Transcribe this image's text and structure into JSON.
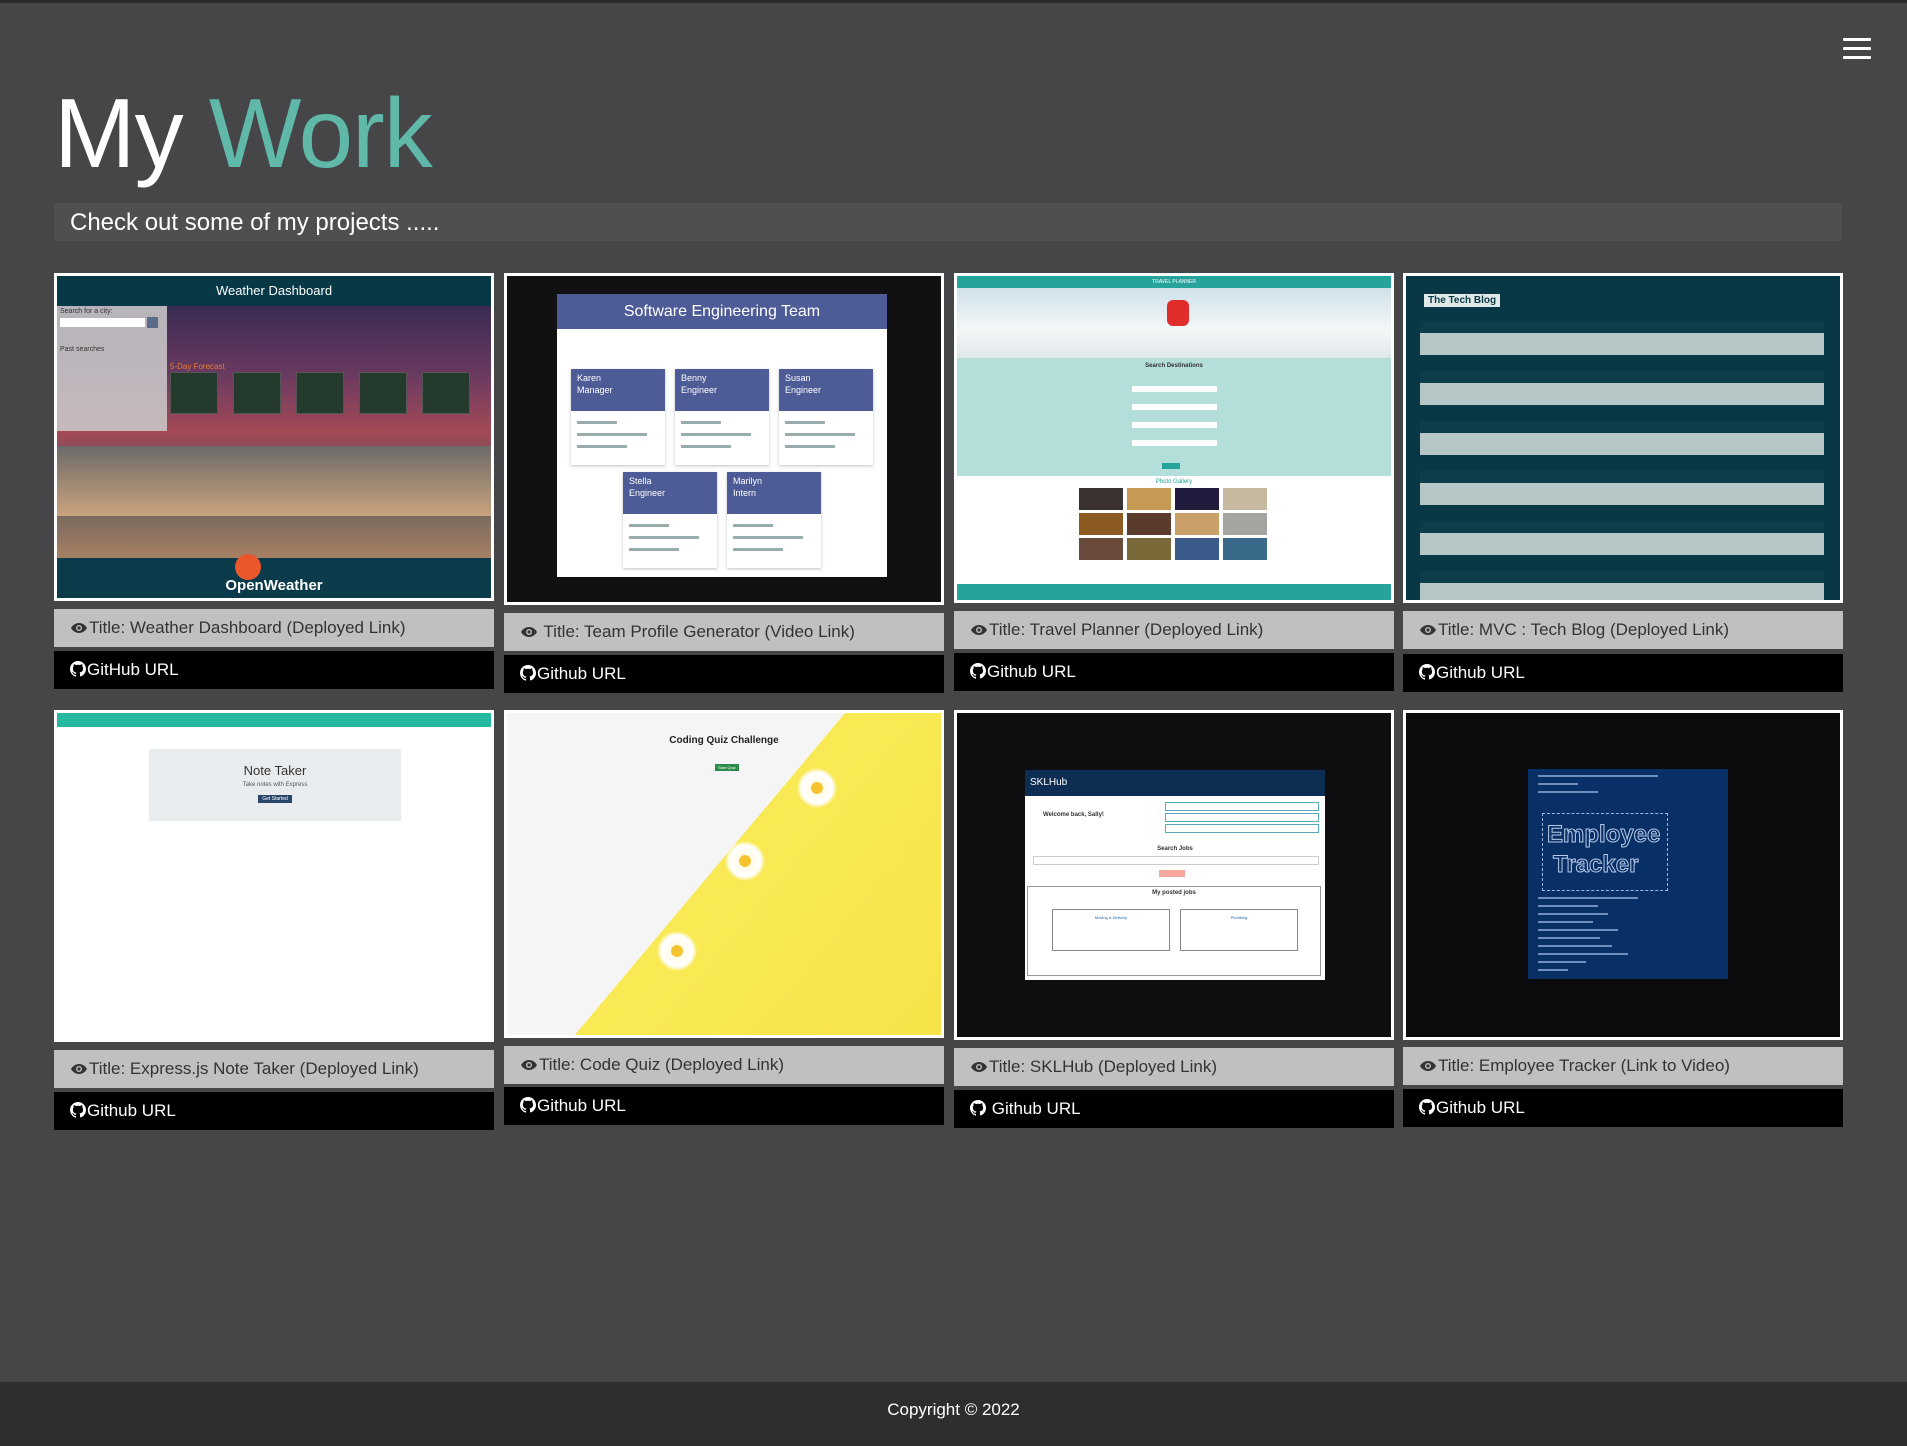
{
  "header": {
    "title_part1": "My",
    "title_part2": "Work",
    "subtitle": "Check out some of my projects ....."
  },
  "colors": {
    "background": "#464648",
    "accent": "#5fb8a8",
    "caption_bg": "#c0c0c0",
    "link_bar_bg": "#000000",
    "footer_bg": "#2e2e30"
  },
  "icons": {
    "menu": "hamburger-menu-icon",
    "caption": "eye-icon",
    "link": "github-icon"
  },
  "projects": [
    {
      "caption": "Title: Weather Dashboard (Deployed Link)",
      "link": "GitHub URL",
      "thumb": {
        "header": "Weather Dashboard",
        "brand": "OpenWeather",
        "search_label": "Search for a city:",
        "past": "Past searches",
        "forecast": "5-Day Forecast"
      }
    },
    {
      "caption": "Title: Team Profile Generator (Video Link)",
      "link": "Github URL",
      "thumb": {
        "header": "Software Engineering Team",
        "members": [
          {
            "name": "Karen",
            "role": "Manager"
          },
          {
            "name": "Benny",
            "role": "Engineer"
          },
          {
            "name": "Susan",
            "role": "Engineer"
          },
          {
            "name": "Stella",
            "role": "Engineer"
          },
          {
            "name": "Marilyn",
            "role": "Intern"
          }
        ]
      }
    },
    {
      "caption": "Title: Travel Planner (Deployed Link)",
      "link": "Github URL",
      "thumb": {
        "header": "TRAVEL PLANNER",
        "section": "Search Destinations",
        "gallery": "Photo Gallery"
      }
    },
    {
      "caption": "Title: MVC : Tech Blog (Deployed Link)",
      "link": "Github URL",
      "thumb": {
        "header": "The Tech Blog"
      }
    },
    {
      "caption": "Title: Express.js Note Taker (Deployed Link)",
      "link": "Github URL",
      "thumb": {
        "header": "Note Taker",
        "tagline": "Take notes with Express",
        "button": "Get Started"
      }
    },
    {
      "caption": "Title: Code Quiz (Deployed Link)",
      "link": "Github URL",
      "thumb": {
        "header": "Coding Quiz Challenge",
        "button": "Start Quiz"
      }
    },
    {
      "caption": "Title: SKLHub (Deployed Link)",
      "link": "Github URL",
      "thumb": {
        "brand": "SKLHub",
        "welcome": "Welcome back, Sally!",
        "search": "Search Jobs",
        "posted": "My posted jobs",
        "job1": "Moving & Delivery",
        "job2": "Plumbing"
      }
    },
    {
      "caption": "Title: Employee Tracker (Link to Video)",
      "link": "Github URL",
      "thumb": {
        "art_line1": "Employee",
        "art_line2": "Tracker"
      }
    }
  ],
  "footer": {
    "copyright": "Copyright © 2022"
  }
}
